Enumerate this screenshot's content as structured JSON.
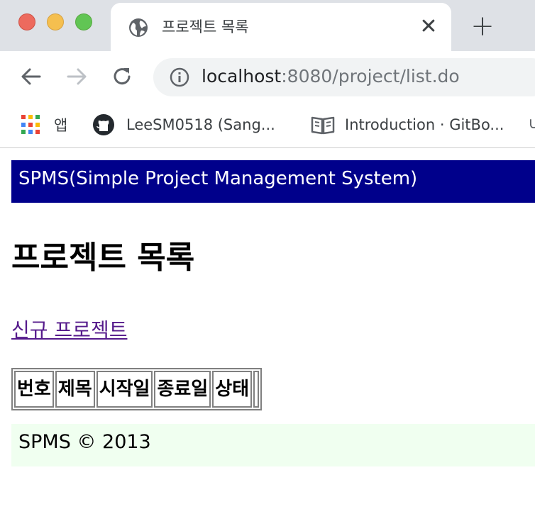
{
  "browser": {
    "tab": {
      "title": "프로젝트 목록",
      "close_glyph": "✕"
    },
    "new_tab_glyph": "+",
    "url": {
      "host": "localhost",
      "rest": ":8080/project/list.do"
    },
    "bookmarks": [
      {
        "label": "앱",
        "icon": "apps-grid-icon"
      },
      {
        "label": "LeeSM0518 (Sang...",
        "icon": "github-icon"
      },
      {
        "label": "Introduction · GitBo...",
        "icon": "book-icon"
      }
    ],
    "bookmark_overflow": "∪"
  },
  "page": {
    "header": "SPMS(Simple Project Management System)",
    "title": "프로젝트 목록",
    "new_project_link": "신규 프로젝트",
    "table": {
      "columns": [
        "번호",
        "제목",
        "시작일",
        "종료일",
        "상태"
      ]
    },
    "footer": "SPMS © 2013"
  },
  "colors": {
    "header_bg": "#00008b",
    "footer_bg": "#f0fff0",
    "link": "#551a8b",
    "tabstrip_bg": "#dee1e6"
  }
}
